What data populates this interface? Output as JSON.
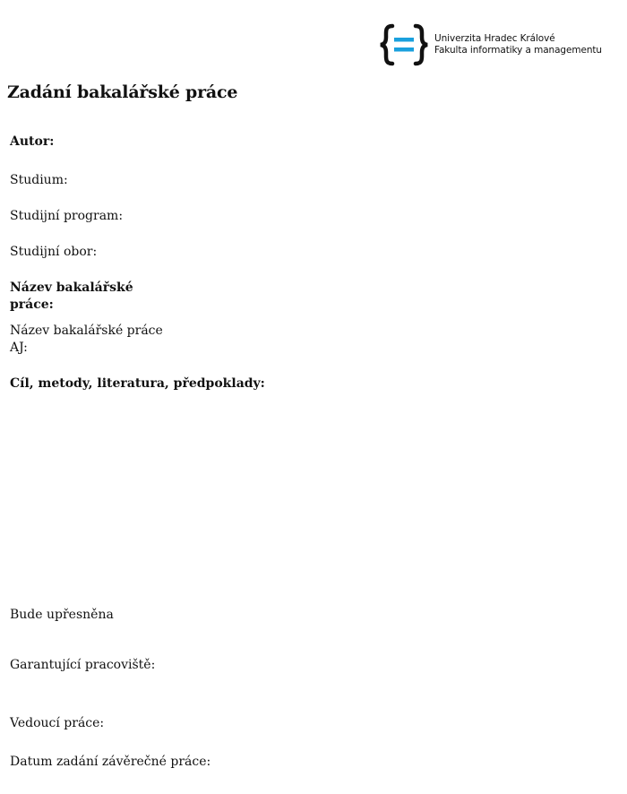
{
  "logo": {
    "line1": "Univerzita Hradec Králové",
    "line2": "Fakulta informatiky a managementu",
    "bracket_color": "#111111",
    "equals_color": "#1aa0dd"
  },
  "document": {
    "title": "Zadání bakalářské práce",
    "fields": {
      "author": "Autor:",
      "study": "Studium:",
      "program": "Studijní program:",
      "field_of_study": "Studijní obor:",
      "thesis_title": "Název bakalářské práce:",
      "thesis_title_en": "Název bakalářské práce AJ:",
      "goals": "Cíl, metody, literatura, předpoklady:",
      "to_be_specified": "Bude upřesněna",
      "department": "Garantující pracoviště:",
      "supervisor": "Vedoucí práce:",
      "assignment_date": "Datum zadání závěrečné práce:"
    }
  }
}
